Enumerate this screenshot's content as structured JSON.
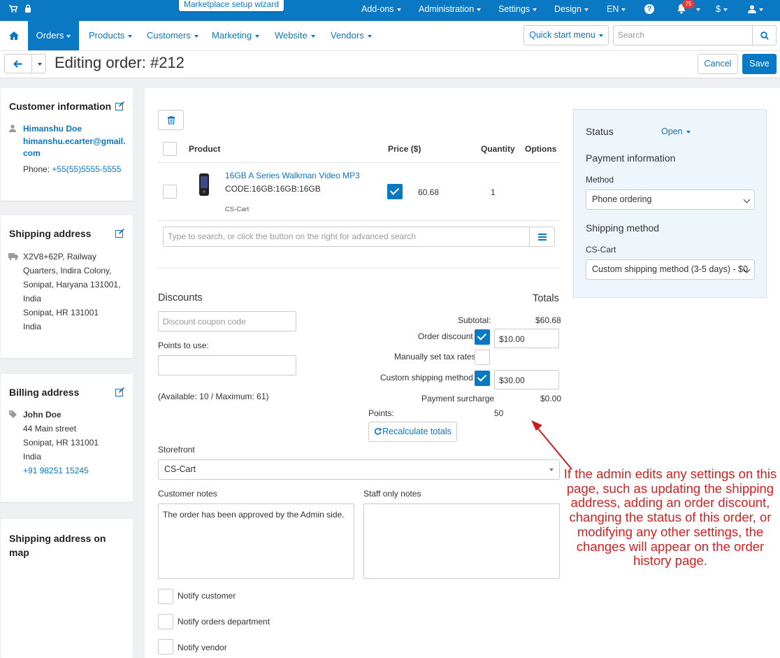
{
  "topbar": {
    "wizard": "Marketplace setup wizard",
    "menu": [
      "Add-ons",
      "Administration",
      "Settings",
      "Design",
      "EN"
    ],
    "notif_count": "75",
    "currency": "$"
  },
  "nav": {
    "items": [
      "Orders",
      "Products",
      "Customers",
      "Marketing",
      "Website",
      "Vendors"
    ],
    "quick_start": "Quick start menu",
    "search_placeholder": "Search"
  },
  "header": {
    "title": "Editing order: #212",
    "cancel": "Cancel",
    "save": "Save"
  },
  "customer_info": {
    "title": "Customer information",
    "name": "Himanshu Doe",
    "email_line1": "himanshu.ecarter@gmail.",
    "email_line2": "com",
    "phone_label": "Phone:",
    "phone": "+55(55)5555-5555"
  },
  "shipping": {
    "title": "Shipping address",
    "lines": [
      "X2V8+62P, Railway",
      "Quarters, Indira Colony,",
      "Sonipat, Haryana 131001,",
      "India",
      "Sonipat, HR 131001",
      "India"
    ]
  },
  "billing": {
    "title": "Billing address",
    "name": "John Doe",
    "lines": [
      "44 Main street",
      "Sonipat, HR 131001",
      "India"
    ],
    "phone": "+91 98251 15245"
  },
  "map_card": {
    "title_line1": "Shipping address on",
    "title_line2": "map"
  },
  "products_table": {
    "headers": [
      "Product",
      "Price ($)",
      "Quantity",
      "Options"
    ],
    "row": {
      "name": "16GB A Series Walkman Video MP3",
      "code": "CODE:16GB:16GB:16GB",
      "vendor": "CS-Cart",
      "price": "60.68",
      "quantity": "1"
    },
    "search_placeholder": "Type to search, or click the button on the right for advanced search"
  },
  "discounts": {
    "title": "Discounts",
    "coupon_placeholder": "Discount coupon code",
    "points_label": "Points to use:",
    "available": "(Available:  10 / Maximum: 61)"
  },
  "totals": {
    "title": "Totals",
    "subtotal_label": "Subtotal:",
    "subtotal": "$60.68",
    "order_discount_label": "Order discount",
    "order_discount": "$10.00",
    "tax_label": "Manually set tax rates",
    "shipping_label": "Custom shipping method",
    "shipping_value": "$30.00",
    "surcharge_label": "Payment surcharge",
    "surcharge": "$0.00",
    "points_label": "Points:",
    "points": "50",
    "recalc": "Recalculate totals"
  },
  "storefront": {
    "label": "Storefront",
    "value": "CS-Cart"
  },
  "notes": {
    "customer_label": "Customer notes",
    "customer_text": "The order has been approved by the Admin side.",
    "staff_label": "Staff only notes"
  },
  "notify": [
    "Notify customer",
    "Notify orders department",
    "Notify vendor"
  ],
  "status_panel": {
    "status_label": "Status",
    "status_value": "Open",
    "payment_title": "Payment information",
    "method_label": "Method",
    "method_value": "Phone ordering",
    "shipping_title": "Shipping method",
    "shipping_vendor": "CS-Cart",
    "shipping_value": "Custom shipping method (3-5 days) - $0"
  },
  "annotation": "If the admin edits any settings on this page, such as updating the shipping address, adding an order discount, changing the status of this order, or modifying any other settings, the changes will appear on the order history page.",
  "colors": {
    "brand": "#0a78c2",
    "annotation": "#d42020"
  }
}
